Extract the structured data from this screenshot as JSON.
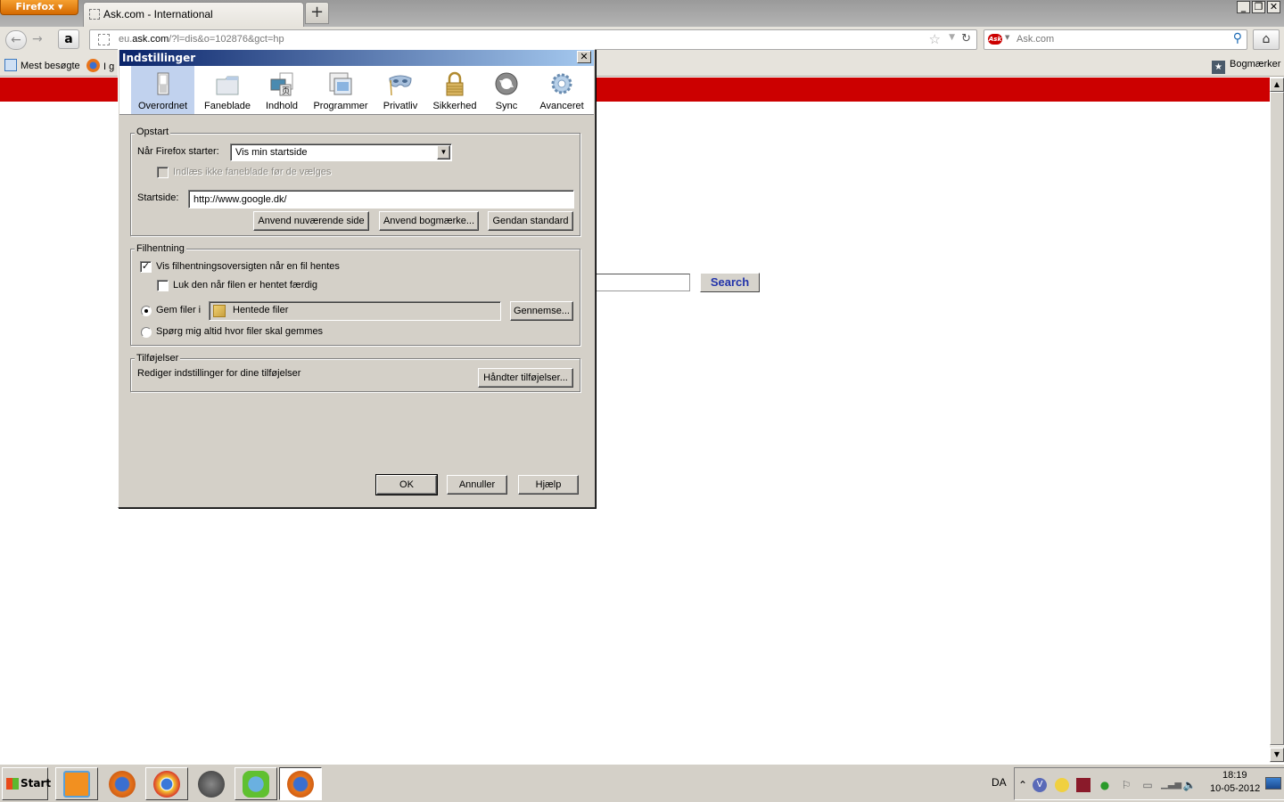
{
  "browser": {
    "menu_button": "Firefox",
    "tabs": [
      {
        "title": "Ask.com - International"
      }
    ],
    "new_tab": "+",
    "window_controls": {
      "minimize": "_",
      "restore": "▫",
      "close": "✕"
    },
    "url": {
      "host_prefix": "eu.",
      "host": "ask.com",
      "path": "/?l=dis&o=102876&gct=hp"
    },
    "search_engine": "Ask.com",
    "search_placeholder": "Ask.com",
    "bookmarks": [
      {
        "label": "Mest besøgte",
        "icon": "search-page-icon"
      },
      {
        "label": "I g",
        "icon": "firefox-icon"
      }
    ],
    "bookmarks_menu": "Bogmærker"
  },
  "page": {
    "brand_color": "#cc0000",
    "search_button": "Search"
  },
  "dialog": {
    "title": "Indstillinger",
    "close": "✕",
    "panes": [
      {
        "label": "Overordnet",
        "icon": "switch-icon",
        "selected": true
      },
      {
        "label": "Faneblade",
        "icon": "folder-tabs-icon",
        "selected": false
      },
      {
        "label": "Indhold",
        "icon": "content-icon",
        "selected": false
      },
      {
        "label": "Programmer",
        "icon": "applications-icon",
        "selected": false
      },
      {
        "label": "Privatliv",
        "icon": "mask-icon",
        "selected": false
      },
      {
        "label": "Sikkerhed",
        "icon": "padlock-icon",
        "selected": false
      },
      {
        "label": "Sync",
        "icon": "sync-icon",
        "selected": false
      },
      {
        "label": "Avanceret",
        "icon": "gear-icon",
        "selected": false
      }
    ],
    "startup": {
      "legend": "Opstart",
      "when_starts_label": "Når Firefox starter:",
      "when_starts_value": "Vis min startside",
      "dont_load_tabs_label": "Indlæs ikke faneblade før de vælges",
      "dont_load_tabs_checked": false,
      "homepage_label": "Startside:",
      "homepage_value": "http://www.google.dk/",
      "use_current": "Anvend nuværende side",
      "use_bookmark": "Anvend bogmærke...",
      "restore_default": "Gendan standard"
    },
    "downloads": {
      "legend": "Filhentning",
      "show_window_label": "Vis filhentningsoversigten når en fil hentes",
      "show_window_checked": true,
      "close_when_done_label": "Luk den når filen er hentet færdig",
      "close_when_done_checked": false,
      "save_to_label": "Gem filer i",
      "save_to_selected": true,
      "save_to_folder": "Hentede filer",
      "browse": "Gennemse...",
      "always_ask_label": "Spørg mig altid hvor filer skal gemmes",
      "always_ask_selected": false
    },
    "addons": {
      "legend": "Tilføjelser",
      "description": "Rediger indstillinger for dine tilføjelser",
      "manage": "Håndter tilføjelser..."
    },
    "buttons": {
      "ok": "OK",
      "cancel": "Annuller",
      "help": "Hjælp"
    }
  },
  "taskbar": {
    "start": "Start",
    "apps": [
      {
        "name": "windows-media-center",
        "active": false
      },
      {
        "name": "firefox",
        "active": false
      },
      {
        "name": "chrome",
        "active": false
      },
      {
        "name": "media-player",
        "active": false
      },
      {
        "name": "messenger",
        "active": false
      },
      {
        "name": "firefox",
        "active": true
      }
    ],
    "language": "DA",
    "time": "18:19",
    "date": "10-05-2012"
  }
}
